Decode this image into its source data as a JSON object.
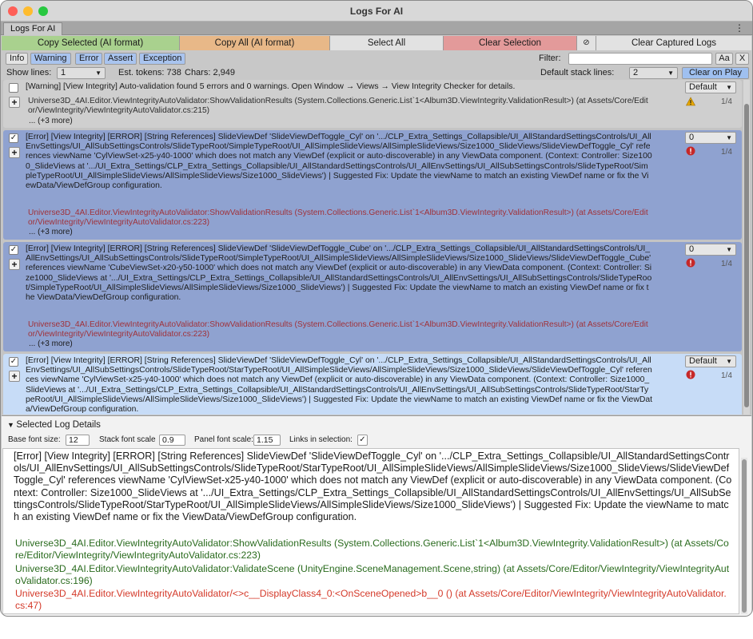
{
  "window": {
    "title": "Logs For AI"
  },
  "tab": {
    "label": "Logs For AI",
    "menu_glyph": "⋮"
  },
  "actions": {
    "copy_selected": "Copy Selected (AI format)",
    "copy_all": "Copy All (AI format)",
    "select_all": "Select All",
    "clear_selection": "Clear Selection",
    "link_glyph": "⊘",
    "clear_captured": "Clear Captured Logs"
  },
  "filters": {
    "info": "Info",
    "warning": "Warning",
    "error": "Error",
    "assert": "Assert",
    "exception": "Exception",
    "filter_label": "Filter:",
    "filter_value": "",
    "case_label": "Aa",
    "clear_label": "X"
  },
  "stats": {
    "show_lines_label": "Show lines:",
    "show_lines_value": "1",
    "tokens": "Est. tokens: 738",
    "chars": "Chars: 2,949",
    "default_stack_label": "Default stack lines:",
    "default_stack_value": "2",
    "clear_on_play": "Clear on Play"
  },
  "entries": [
    {
      "checked": "",
      "message": "[Warning] [View Integrity] Auto-validation found 5 errors and 0 warnings. Open Window → Views → View Integrity Checker for details.",
      "stack": "Universe3D_4AI.Editor.ViewIntegrityAutoValidator:ShowValidationResults (System.Collections.Generic.List`1<Album3D.ViewIntegrity.ValidationResult>) (at Assets/Core/Editor/ViewIntegrity/ViewIntegrityAutoValidator.cs:215)",
      "more": "... (+3 more)",
      "dropdown": "Default",
      "icon": "warning-icon",
      "count": "1/4"
    },
    {
      "checked": "✓",
      "message": "[Error] [View Integrity] [ERROR] [String References] SlideViewDef 'SlideViewDefToggle_Cyl' on '.../CLP_Extra_Settings_Collapsible/UI_AllStandardSettingsControls/UI_AllEnvSettings/UI_AllSubSettingsControls/SlideTypeRoot/SimpleTypeRoot/UI_AllSimpleSlideViews/AllSimpleSlideViews/Size1000_SlideViews/SlideViewDefToggle_Cyl' references viewName 'CylViewSet-x25-y40-1000' which does not match any ViewDef (explicit or auto-discoverable) in any ViewData component. (Context: Controller: Size1000_SlideViews at '.../UI_Extra_Settings/CLP_Extra_Settings_Collapsible/UI_AllStandardSettingsControls/UI_AllEnvSettings/UI_AllSubSettingsControls/SlideTypeRoot/SimpleTypeRoot/UI_AllSimpleSlideViews/AllSimpleSlideViews/Size1000_SlideViews') | Suggested Fix: Update the viewName to match an existing ViewDef name or fix the ViewData/ViewDefGroup configuration.",
      "stack": "Universe3D_4AI.Editor.ViewIntegrityAutoValidator:ShowValidationResults (System.Collections.Generic.List`1<Album3D.ViewIntegrity.ValidationResult>) (at Assets/Core/Editor/ViewIntegrity/ViewIntegrityAutoValidator.cs:223)",
      "more": "... (+3 more)",
      "dropdown": "0",
      "icon": "error-icon",
      "count": "1/4"
    },
    {
      "checked": "✓",
      "message": "[Error] [View Integrity] [ERROR] [String References] SlideViewDef 'SlideViewDefToggle_Cube' on '.../CLP_Extra_Settings_Collapsible/UI_AllStandardSettingsControls/UI_AllEnvSettings/UI_AllSubSettingsControls/SlideTypeRoot/SimpleTypeRoot/UI_AllSimpleSlideViews/AllSimpleSlideViews/Size1000_SlideViews/SlideViewDefToggle_Cube' references viewName 'CubeViewSet-x20-y50-1000' which does not match any ViewDef (explicit or auto-discoverable) in any ViewData component. (Context: Controller: Size1000_SlideViews at '.../UI_Extra_Settings/CLP_Extra_Settings_Collapsible/UI_AllStandardSettingsControls/UI_AllEnvSettings/UI_AllSubSettingsControls/SlideTypeRoot/SimpleTypeRoot/UI_AllSimpleSlideViews/AllSimpleSlideViews/Size1000_SlideViews') | Suggested Fix: Update the viewName to match an existing ViewDef name or fix the ViewData/ViewDefGroup configuration.",
      "stack": "Universe3D_4AI.Editor.ViewIntegrityAutoValidator:ShowValidationResults (System.Collections.Generic.List`1<Album3D.ViewIntegrity.ValidationResult>) (at Assets/Core/Editor/ViewIntegrity/ViewIntegrityAutoValidator.cs:223)",
      "more": "... (+3 more)",
      "dropdown": "0",
      "icon": "error-icon",
      "count": "1/4"
    },
    {
      "checked": "✓",
      "message": "[Error] [View Integrity] [ERROR] [String References] SlideViewDef 'SlideViewDefToggle_Cyl' on '.../CLP_Extra_Settings_Collapsible/UI_AllStandardSettingsControls/UI_AllEnvSettings/UI_AllSubSettingsControls/SlideTypeRoot/StarTypeRoot/UI_AllSimpleSlideViews/AllSimpleSlideViews/Size1000_SlideViews/SlideViewDefToggle_Cyl' references viewName 'CylViewSet-x25-y40-1000' which does not match any ViewDef (explicit or auto-discoverable) in any ViewData component. (Context: Controller: Size1000_SlideViews at '.../UI_Extra_Settings/CLP_Extra_Settings_Collapsible/UI_AllStandardSettingsControls/UI_AllEnvSettings/UI_AllSubSettingsControls/SlideTypeRoot/StarTypeRoot/UI_AllSimpleSlideViews/AllSimpleSlideViews/Size1000_SlideViews') | Suggested Fix: Update the viewName to match an existing ViewDef name or fix the ViewData/ViewDefGroup configuration.",
      "stack": "",
      "more": "",
      "dropdown": "Default",
      "icon": "error-icon",
      "count": "1/4"
    }
  ],
  "details": {
    "title": "Selected Log Details",
    "base_font_label": "Base font size:",
    "base_font_value": "12",
    "stack_scale_label": "Stack font scale",
    "stack_scale_value": "0.9",
    "panel_scale_label": "Panel font scale:",
    "panel_scale_value": "1.15",
    "links_label": "Links in selection:",
    "links_checked": "✓",
    "message": "[Error] [View Integrity] [ERROR] [String References] SlideViewDef 'SlideViewDefToggle_Cyl' on '.../CLP_Extra_Settings_Collapsible/UI_AllStandardSettingsControls/UI_AllEnvSettings/UI_AllSubSettingsControls/SlideTypeRoot/StarTypeRoot/UI_AllSimpleSlideViews/AllSimpleSlideViews/Size1000_SlideViews/SlideViewDefToggle_Cyl' references viewName 'CylViewSet-x25-y40-1000' which does not match any ViewDef (explicit or auto-discoverable) in any ViewData component. (Context: Controller: Size1000_SlideViews at '.../UI_Extra_Settings/CLP_Extra_Settings_Collapsible/UI_AllStandardSettingsControls/UI_AllEnvSettings/UI_AllSubSettingsControls/SlideTypeRoot/StarTypeRoot/UI_AllSimpleSlideViews/AllSimpleSlideViews/Size1000_SlideViews') | Suggested Fix: Update the viewName to match an existing ViewDef name or fix the ViewData/ViewDefGroup configuration.",
    "stack1": "Universe3D_4AI.Editor.ViewIntegrityAutoValidator:ShowValidationResults (System.Collections.Generic.List`1<Album3D.ViewIntegrity.ValidationResult>) (at Assets/Core/Editor/ViewIntegrity/ViewIntegrityAutoValidator.cs:223)",
    "stack2": "Universe3D_4AI.Editor.ViewIntegrityAutoValidator:ValidateScene (UnityEngine.SceneManagement.Scene,string) (at Assets/Core/Editor/ViewIntegrity/ViewIntegrityAutoValidator.cs:196)",
    "stack3": "Universe3D_4AI.Editor.ViewIntegrityAutoValidator/<>c__DisplayClass4_0:<OnSceneOpened>b__0 () (at Assets/Core/Editor/ViewIntegrity/ViewIntegrityAutoValidator.cs:47)"
  },
  "colors": {
    "warning_row": "#cfcfcf",
    "error_row": "#8fa2d0",
    "selected_row": "#c7dcf7",
    "stack_error": "#a0323a",
    "stack_green": "#2a6b1e",
    "stack_red": "#d43a2a",
    "copy_selected_bg": "#a9d18e",
    "copy_all_bg": "#e8b888",
    "clear_selection_bg": "#e39a9a",
    "filter_chip_active": "#a9c4ef",
    "accent_button": "#9fc0f0"
  }
}
